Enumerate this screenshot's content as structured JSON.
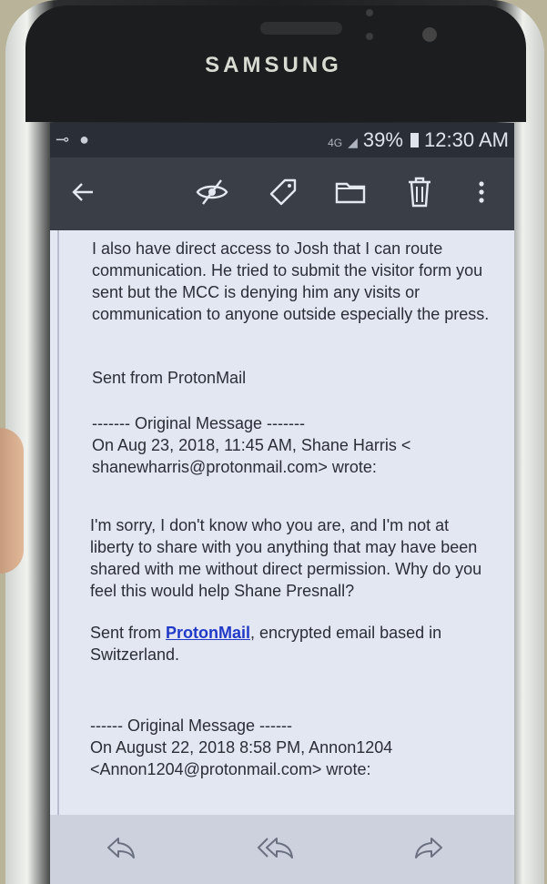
{
  "device": {
    "brand": "SAMSUNG"
  },
  "status_bar": {
    "network": "4G",
    "battery": "39%",
    "time": "12:30 AM"
  },
  "toolbar": {
    "back_icon": "arrow-left-icon",
    "icons": [
      "eye-off-icon",
      "tag-icon",
      "folder-icon",
      "trash-icon",
      "more-vertical-icon"
    ]
  },
  "email": {
    "para1": "I also have direct access to Josh that I can route communication. He tried to submit the visitor form you sent but the MCC is denying him any visits or communication to anyone outside especially the press.",
    "sig1": "Sent from ProtonMail",
    "orig1_header": "------- Original Message -------",
    "orig1_line": "On Aug 23, 2018, 11:45 AM, Shane Harris < shanewharris@protonmail.com> wrote:",
    "para2": "I'm sorry, I don't know who you are, and I'm not at liberty to share with you anything that may have been shared with me without direct permission. Why do you feel this would help Shane Presnall?",
    "sig2_prefix": "Sent from ",
    "sig2_link": "ProtonMail",
    "sig2_suffix": ", encrypted email based in Switzerland.",
    "orig2_header": "------ Original Message ------",
    "orig2_line": "On August 22, 2018 8:58 PM, Annon1204 <Annon1204@protonmail.com> wrote:"
  },
  "bottom_bar": {
    "icons": [
      "reply-icon",
      "reply-all-icon",
      "forward-icon"
    ]
  }
}
